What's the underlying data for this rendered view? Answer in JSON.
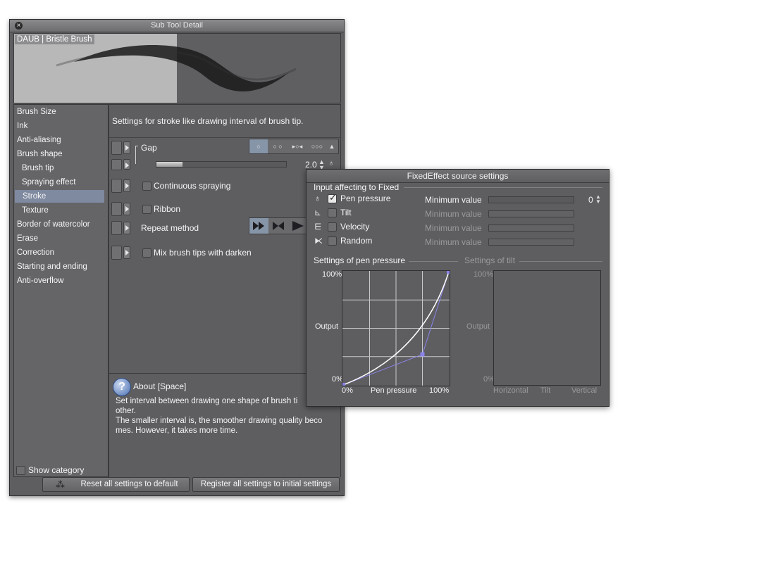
{
  "window": {
    "title": "Sub Tool Detail",
    "close_glyph": "×",
    "preview_label": "DAUB | Bristle Brush"
  },
  "categories": [
    {
      "label": "Brush Size",
      "sub": false,
      "selected": false
    },
    {
      "label": "Ink",
      "sub": false,
      "selected": false
    },
    {
      "label": "Anti-aliasing",
      "sub": false,
      "selected": false
    },
    {
      "label": "Brush shape",
      "sub": false,
      "selected": false
    },
    {
      "label": "Brush tip",
      "sub": true,
      "selected": false
    },
    {
      "label": "Spraying effect",
      "sub": true,
      "selected": false
    },
    {
      "label": "Stroke",
      "sub": true,
      "selected": true
    },
    {
      "label": "Texture",
      "sub": true,
      "selected": false
    },
    {
      "label": "Border of watercolor",
      "sub": false,
      "selected": false
    },
    {
      "label": "Erase",
      "sub": false,
      "selected": false
    },
    {
      "label": "Correction",
      "sub": false,
      "selected": false
    },
    {
      "label": "Starting and ending",
      "sub": false,
      "selected": false
    },
    {
      "label": "Anti-overflow",
      "sub": false,
      "selected": false
    }
  ],
  "show_category_label": "Show category",
  "content": {
    "description": "Settings for stroke like drawing interval of brush tip.",
    "gap_label": "Gap",
    "gap_icons": [
      "○",
      "○ ○",
      "▸○◂",
      "○○○"
    ],
    "gap_value": "2.0",
    "gap_fraction": 0.2,
    "continuous_spraying": "Continuous spraying",
    "ribbon": "Ribbon",
    "repeat_method": "Repeat method",
    "mix_brush_tips": "Mix brush tips with darken"
  },
  "about": {
    "icon": "?",
    "title": "About [Space]",
    "lines": [
      "Set interval between drawing one shape of brush ti",
      "other.",
      "The smaller interval is, the smoother drawing quality beco",
      "mes. However, it takes more time."
    ]
  },
  "buttons": {
    "reset": "Reset all settings to default",
    "register": "Register all settings to initial settings"
  },
  "popup": {
    "title": "FixedEffect source settings",
    "input_label": "Input affecting to Fixed",
    "inputs": [
      {
        "label": "Pen pressure",
        "checked": true,
        "icon": "pen-pressure-icon",
        "min_label": "Minimum value",
        "min_value": "0",
        "enabled": true
      },
      {
        "label": "Tilt",
        "checked": false,
        "icon": "tilt-icon",
        "min_label": "Minimum value",
        "enabled": false
      },
      {
        "label": "Velocity",
        "checked": false,
        "icon": "velocity-icon",
        "min_label": "Minimum value",
        "enabled": false
      },
      {
        "label": "Random",
        "checked": false,
        "icon": "random-icon",
        "min_label": "Minimum value",
        "enabled": false
      }
    ],
    "pressure_section": "Settings of pen pressure",
    "tilt_section": "Settings of tilt",
    "graph": {
      "y_top": "100%",
      "y_mid": "Output",
      "y_bottom": "0%",
      "x_left": "0%",
      "x_mid": "Pen pressure",
      "x_right": "100%"
    },
    "tilt_graph": {
      "y_top": "100%",
      "y_mid": "Output",
      "y_bottom": "0%",
      "x_left": "Horizontal",
      "x_mid": "Tilt",
      "x_right": "Vertical"
    },
    "curve_points": [
      [
        0,
        0
      ],
      [
        0.75,
        0.27
      ],
      [
        1,
        1
      ]
    ]
  },
  "colors": {
    "selection": "#7f8aa0",
    "curve_control": "#8a84e8",
    "panel": "#5e5e61"
  }
}
